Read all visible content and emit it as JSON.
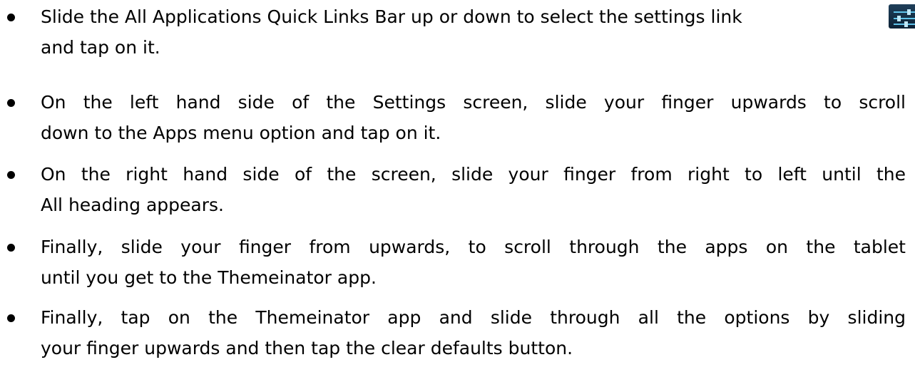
{
  "instructions": [
    {
      "line1": "Slide the All Applications Quick Links Bar up or down to select the settings link",
      "line2": "and tap on it."
    },
    {
      "line1": "On the left hand side of the Settings screen, slide your finger upwards to scroll",
      "line2": "down to the Apps menu option and tap on it."
    },
    {
      "line1": "On the right hand side of the screen, slide your finger from right to left until the",
      "line2": "All heading appears."
    },
    {
      "line1": "Finally, slide your finger from upwards, to scroll through the apps on the tablet",
      "line2": "until you get to the Themeinator app."
    },
    {
      "line1": "Finally, tap on the Themeinator app and slide through all the options by sliding",
      "line2": "your finger upwards and then tap the clear defaults button."
    }
  ],
  "icons": {
    "settings": "settings-sliders-icon",
    "settings_color": "#1f3f5a"
  }
}
